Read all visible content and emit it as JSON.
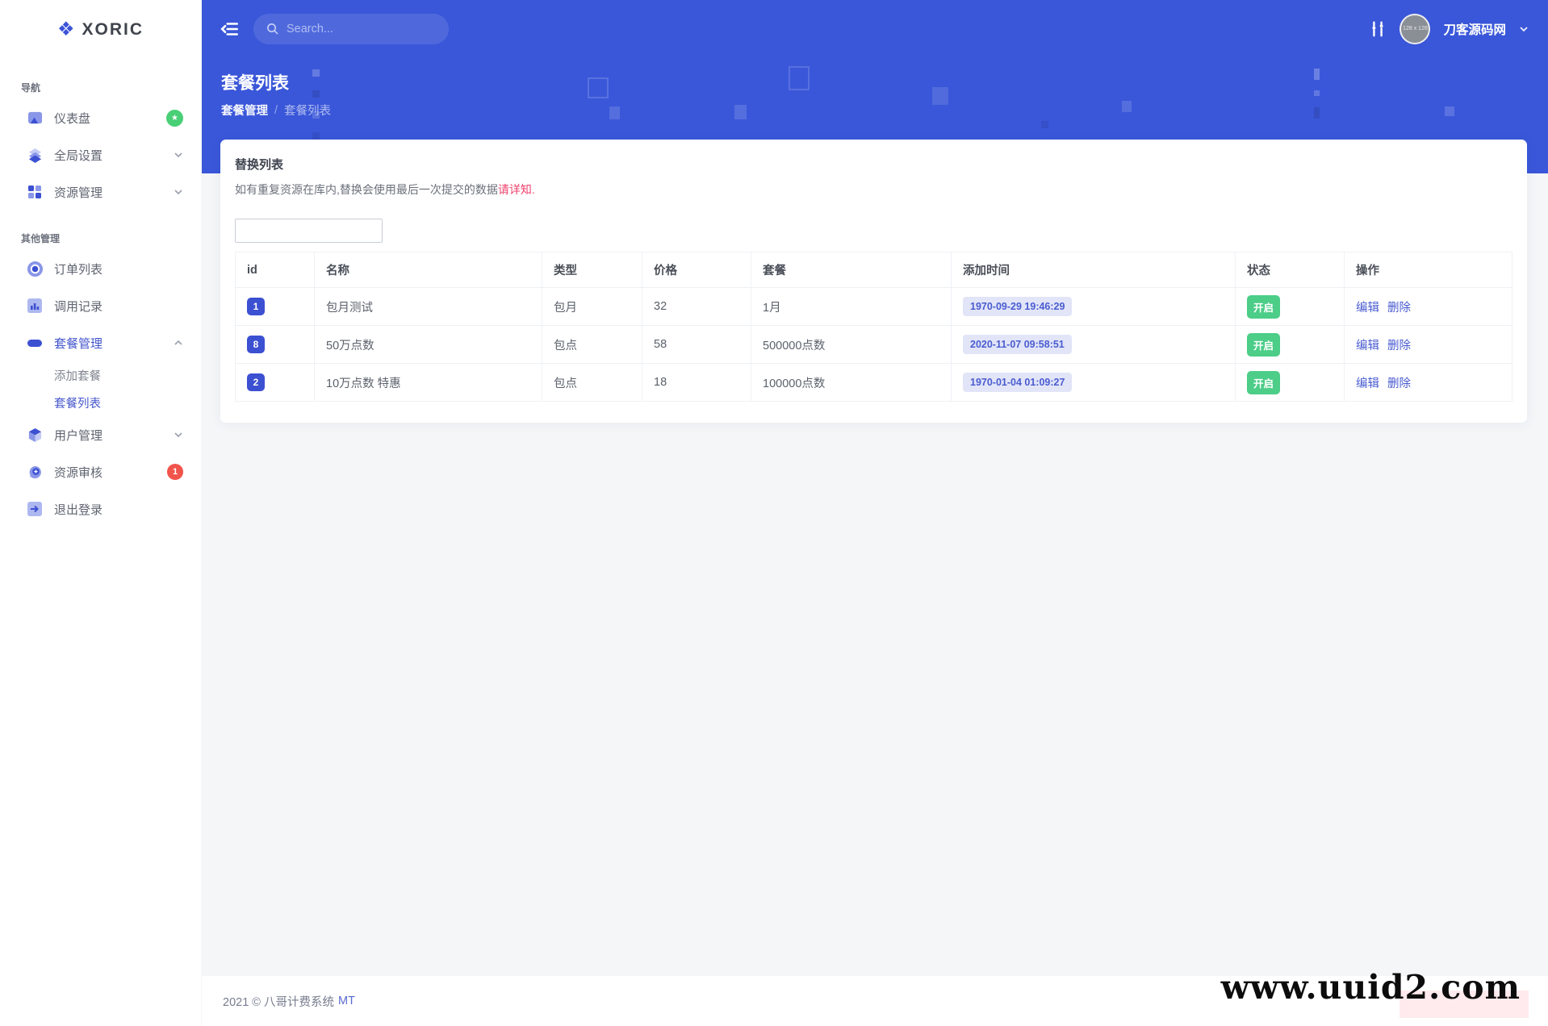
{
  "app": {
    "logo_icon": "❖",
    "logo_text": "XORIC"
  },
  "topbar": {
    "search_placeholder": "Search...",
    "username": "刀客源码网",
    "avatar_text": "128 x 128"
  },
  "page": {
    "title": "套餐列表",
    "breadcrumb_parent": "套餐管理",
    "breadcrumb_sep": "/",
    "breadcrumb_current": "套餐列表"
  },
  "sidebar": {
    "section1_label": "导航",
    "section2_label": "其他管理",
    "items": {
      "dashboard": "仪表盘",
      "global_settings": "全局设置",
      "resource_mgmt": "资源管理",
      "order_list": "订单列表",
      "call_log": "调用记录",
      "package_mgmt": "套餐管理",
      "add_package": "添加套餐",
      "package_list": "套餐列表",
      "user_mgmt": "用户管理",
      "resource_audit": "资源审核",
      "logout": "退出登录"
    },
    "badges": {
      "dashboard_star": "★",
      "audit_count": "1"
    }
  },
  "card": {
    "title": "替换列表",
    "desc": "如有重复资源在库内,替换会使用最后一次提交的数据",
    "desc_link": "请详知",
    "desc_suffix": "."
  },
  "table": {
    "headers": [
      "id",
      "名称",
      "类型",
      "价格",
      "套餐",
      "添加时间",
      "状态",
      "操作"
    ],
    "status_label": "开启",
    "rows": [
      {
        "id": "1",
        "name": "包月测试",
        "type": "包月",
        "price": "32",
        "package": "1月",
        "time": "1970-09-29 19:46:29",
        "status": "开启",
        "edit": "编辑",
        "del": "删除"
      },
      {
        "id": "8",
        "name": "50万点数",
        "type": "包点",
        "price": "58",
        "package": "500000点数",
        "time": "2020-11-07 09:58:51",
        "status": "开启",
        "edit": "编辑",
        "del": "删除"
      },
      {
        "id": "2",
        "name": "10万点数 特惠",
        "type": "包点",
        "price": "18",
        "package": "100000点数",
        "time": "1970-01-04 01:09:27",
        "status": "开启",
        "edit": "编辑",
        "del": "删除"
      }
    ]
  },
  "footer": {
    "text": "2021 © 八哥计费系统",
    "link": "MT"
  },
  "watermark": "www.uuid2.com",
  "colors": {
    "header_blue": "#3a57d9",
    "accent_blue": "#4a5cd0",
    "green": "#4ccd88",
    "pink": "#f1416c",
    "red_badge": "#f1544b"
  }
}
